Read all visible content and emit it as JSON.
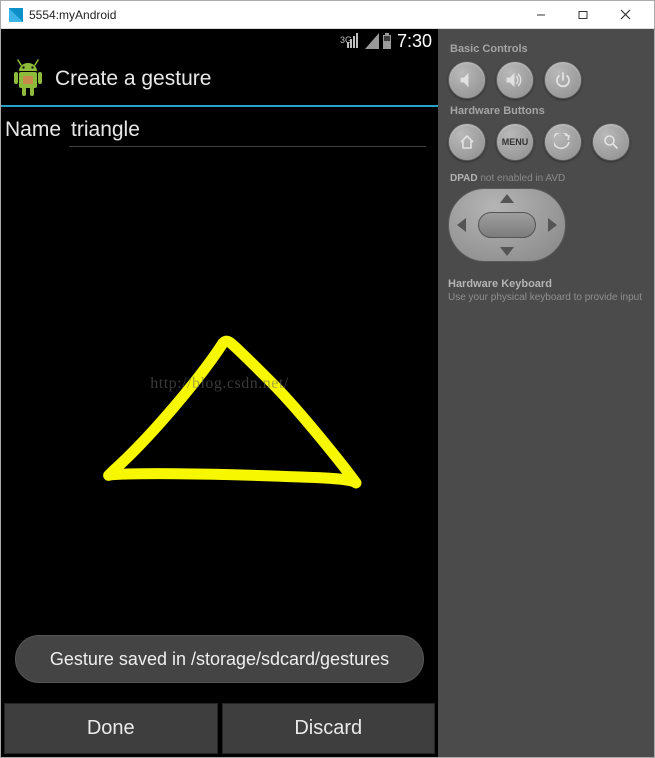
{
  "window": {
    "title": "5554:myAndroid"
  },
  "statusbar": {
    "network_mode": "3G",
    "time": "7:30"
  },
  "app": {
    "header_title": "Create a gesture",
    "name_label": "Name",
    "name_value": "triangle",
    "watermark": "http://blog.csdn.net/",
    "toast": "Gesture saved in /storage/sdcard/gestures",
    "done_label": "Done",
    "discard_label": "Discard",
    "gesture_stroke_color": "#f7f700"
  },
  "emulator_panel": {
    "sections": {
      "basic_controls": "Basic Controls",
      "hardware_buttons": "Hardware Buttons",
      "dpad_label": "DPAD",
      "dpad_note": "not enabled in AVD",
      "hw_keyboard_title": "Hardware Keyboard",
      "hw_keyboard_note": "Use your physical keyboard to provide input"
    },
    "buttons": {
      "volume_down": "volume-down",
      "volume_up": "volume-up",
      "power": "power",
      "home": "home",
      "menu_label": "MENU",
      "back": "back",
      "search": "search"
    }
  }
}
